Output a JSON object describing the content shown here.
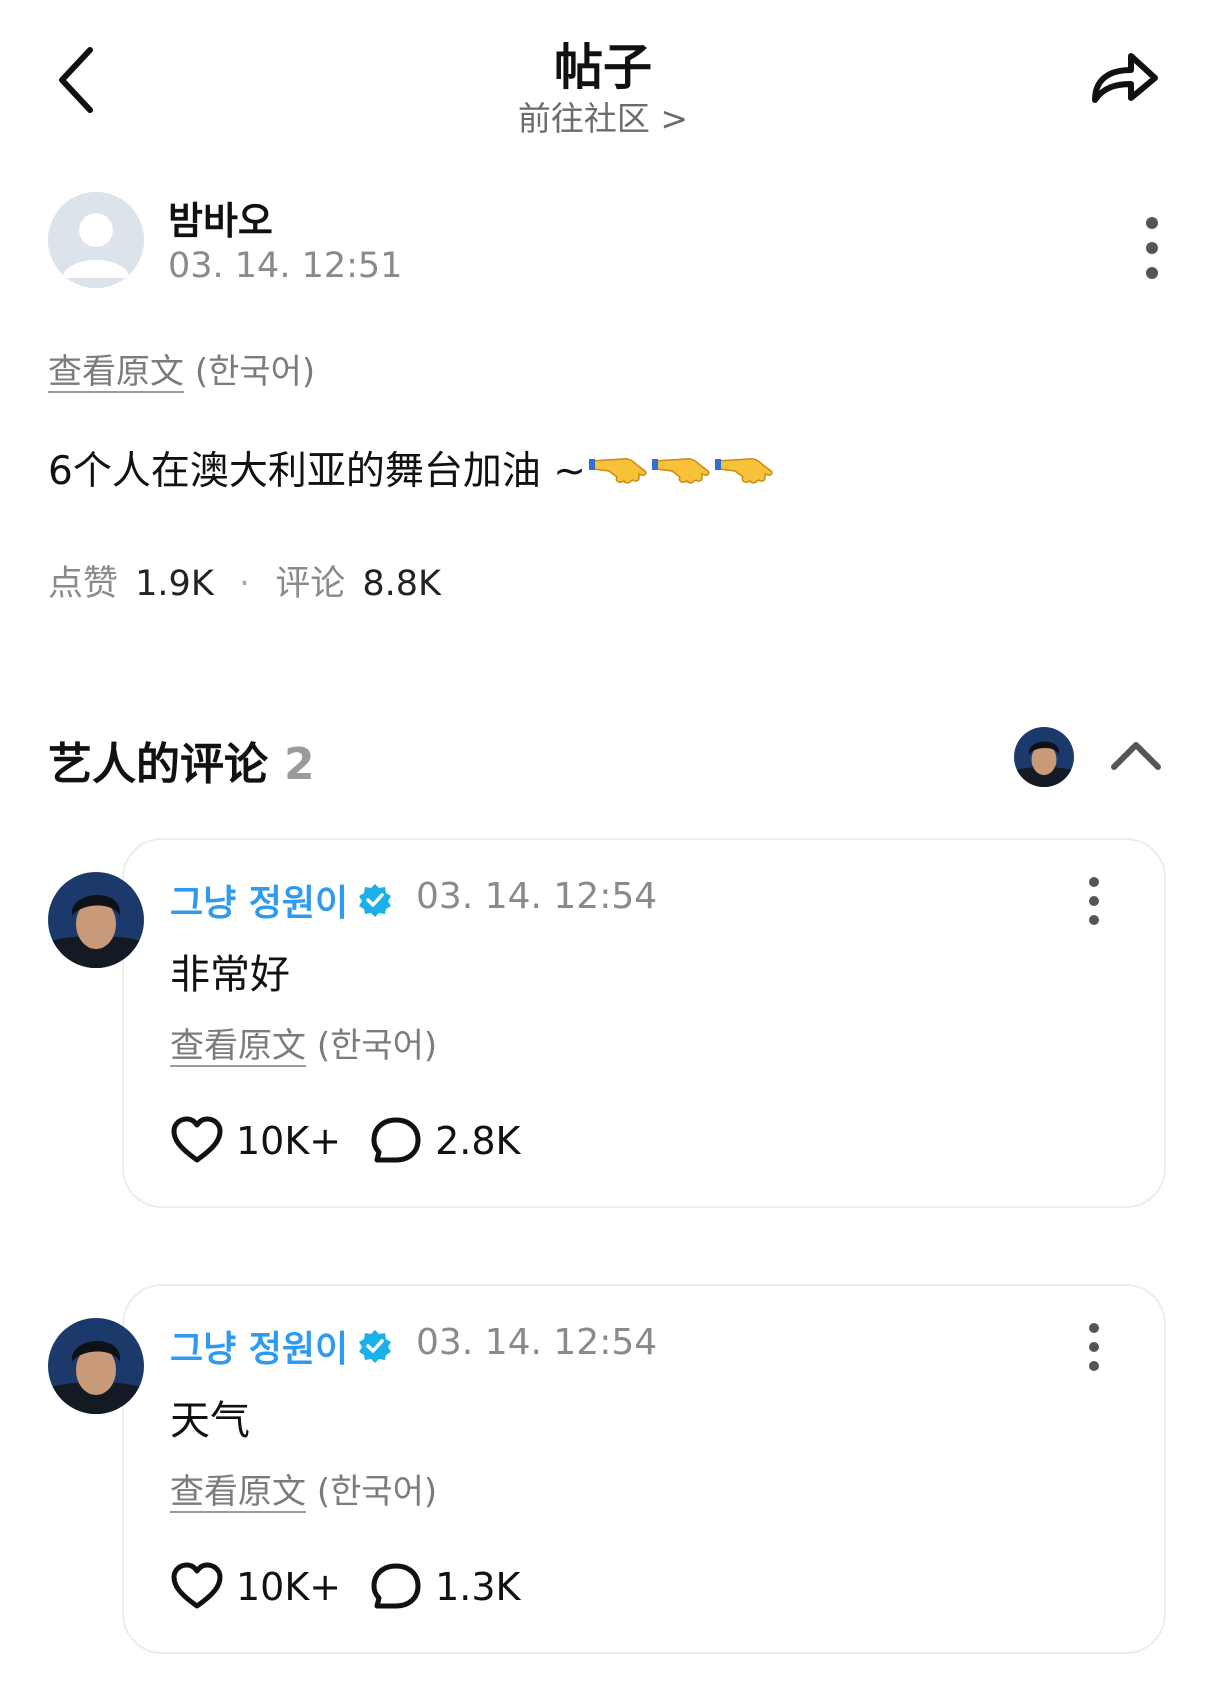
{
  "header": {
    "title": "帖子",
    "subtitle": "前往社区 >"
  },
  "post": {
    "author": "밤바오",
    "time": "03. 14. 12:51",
    "translate_link": "查看原文",
    "translate_lang": "(한국어)",
    "body": "6个人在澳大利亚的舞台加油 ~",
    "emoji": [
      "hand-pointing-icon",
      "hand-pointing-icon",
      "hand-pointing-icon"
    ],
    "stats": {
      "likes_label": "点赞",
      "likes": "1.9K",
      "separator": "·",
      "comments_label": "评论",
      "comments": "8.8K"
    }
  },
  "artist_comments": {
    "title": "艺人的评论",
    "count": "2",
    "items": [
      {
        "name": "그냥 정원이",
        "time": "03. 14. 12:54",
        "text": "非常好",
        "translate_link": "查看原文",
        "translate_lang": "(한국어)",
        "likes": "10K+",
        "replies": "2.8K"
      },
      {
        "name": "그냥 정원이",
        "time": "03. 14. 12:54",
        "text": "天气",
        "translate_link": "查看原文",
        "translate_lang": "(한국어)",
        "likes": "10K+",
        "replies": "1.3K"
      }
    ]
  },
  "colors": {
    "artist_name": "#2f9bf0",
    "verified_badge": "#1bb0e8",
    "muted_text": "#8a8a8a",
    "card_border": "#ececec"
  }
}
